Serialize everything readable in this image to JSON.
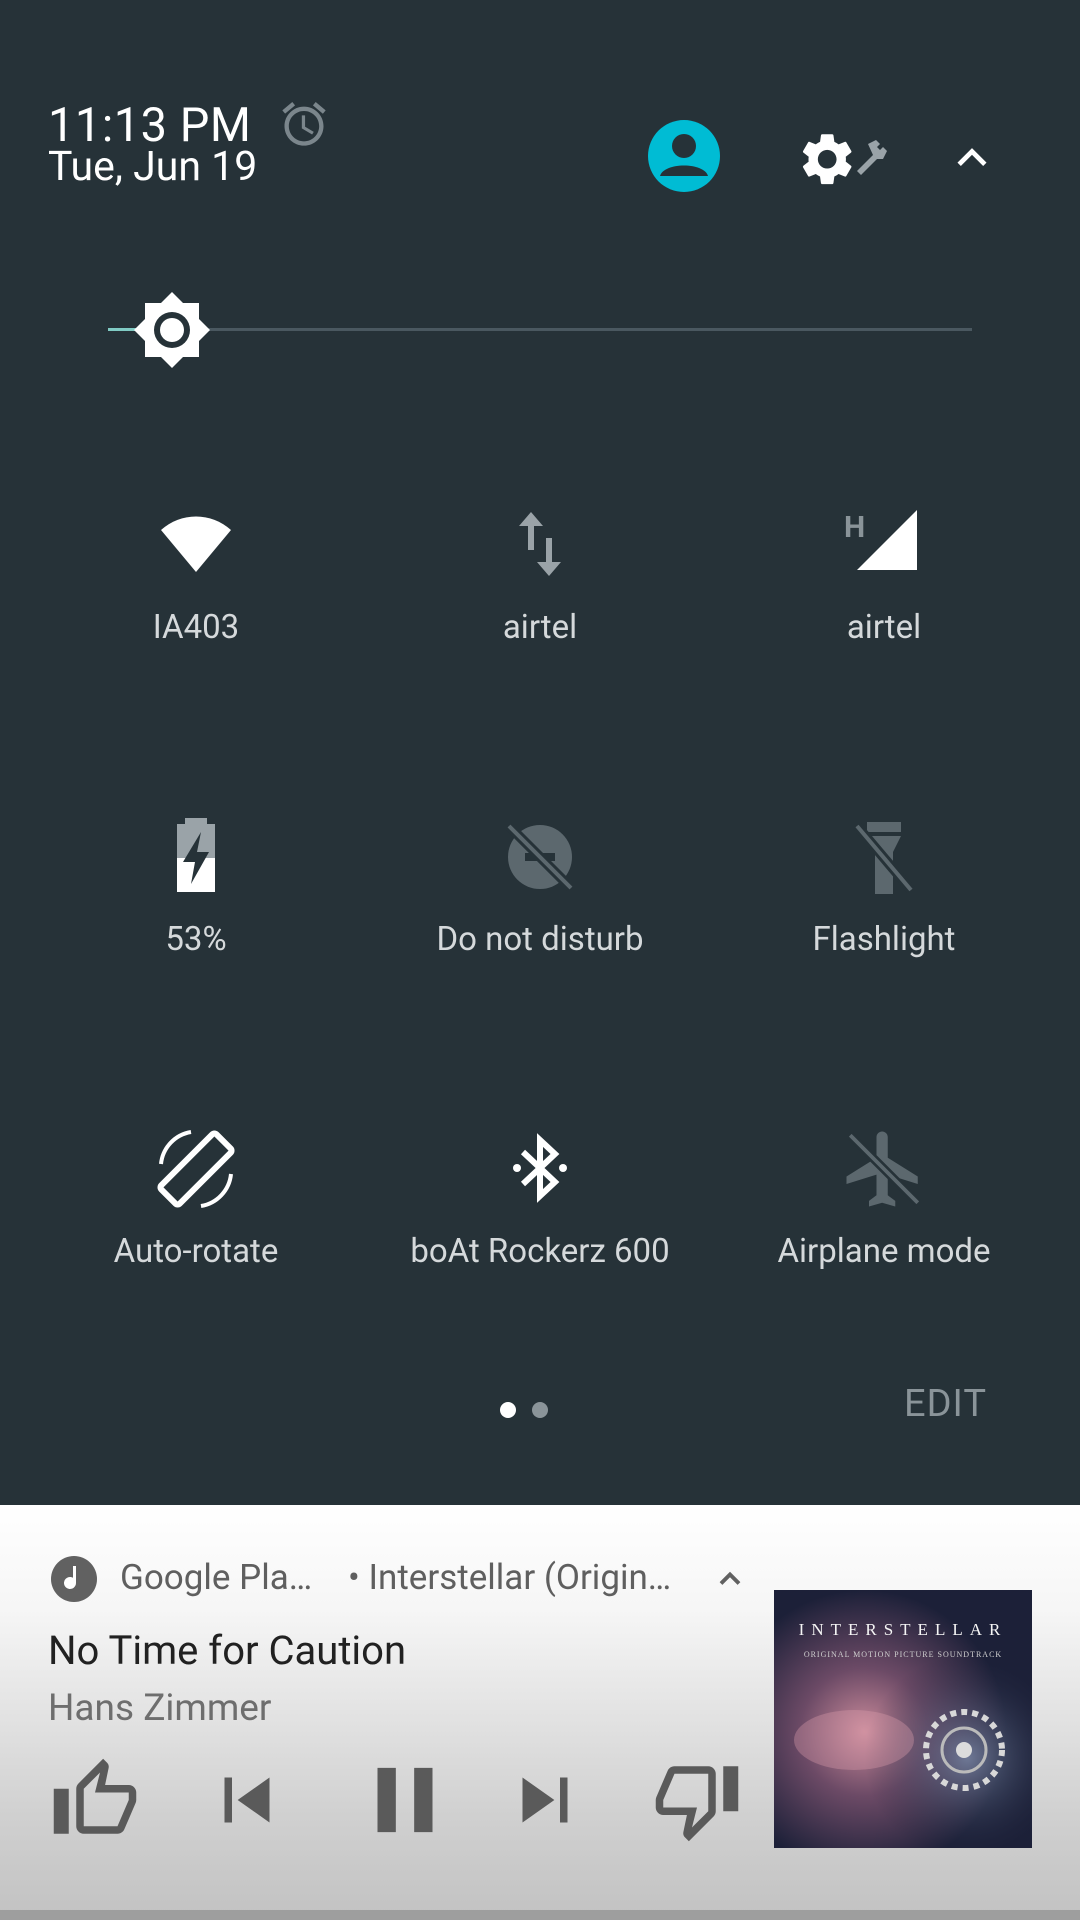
{
  "header": {
    "time": "11:13 PM",
    "date": "Tue, Jun 19",
    "accent_color": "#00bcd4"
  },
  "brightness": {
    "level_fraction": 0.07
  },
  "tiles": [
    {
      "label": "IA403",
      "icon": "wifi-icon",
      "active": true
    },
    {
      "label": "airtel",
      "icon": "mobile-data-icon",
      "active": false
    },
    {
      "label": "airtel",
      "icon": "cellular-signal-icon",
      "active": true,
      "badge": "H"
    },
    {
      "label": "53%",
      "icon": "battery-charging-icon",
      "active": true
    },
    {
      "label": "Do not disturb",
      "icon": "do-not-disturb-icon",
      "active": false
    },
    {
      "label": "Flashlight",
      "icon": "flashlight-icon",
      "active": false
    },
    {
      "label": "Auto-rotate",
      "icon": "auto-rotate-icon",
      "active": true
    },
    {
      "label": "boAt Rockerz 600",
      "icon": "bluetooth-icon",
      "active": true
    },
    {
      "label": "Airplane mode",
      "icon": "airplane-icon",
      "active": false
    }
  ],
  "pager": {
    "pages": 2,
    "current": 1
  },
  "edit_label": "EDIT",
  "media": {
    "app_name": "Google Pla…",
    "subtitle": "• Interstellar (Origin…",
    "title": "No Time for Caution",
    "artist": "Hans Zimmer",
    "album_art_text": "INTERSTELLAR",
    "album_art_subtext": "ORIGINAL MOTION PICTURE SOUNDTRACK"
  }
}
